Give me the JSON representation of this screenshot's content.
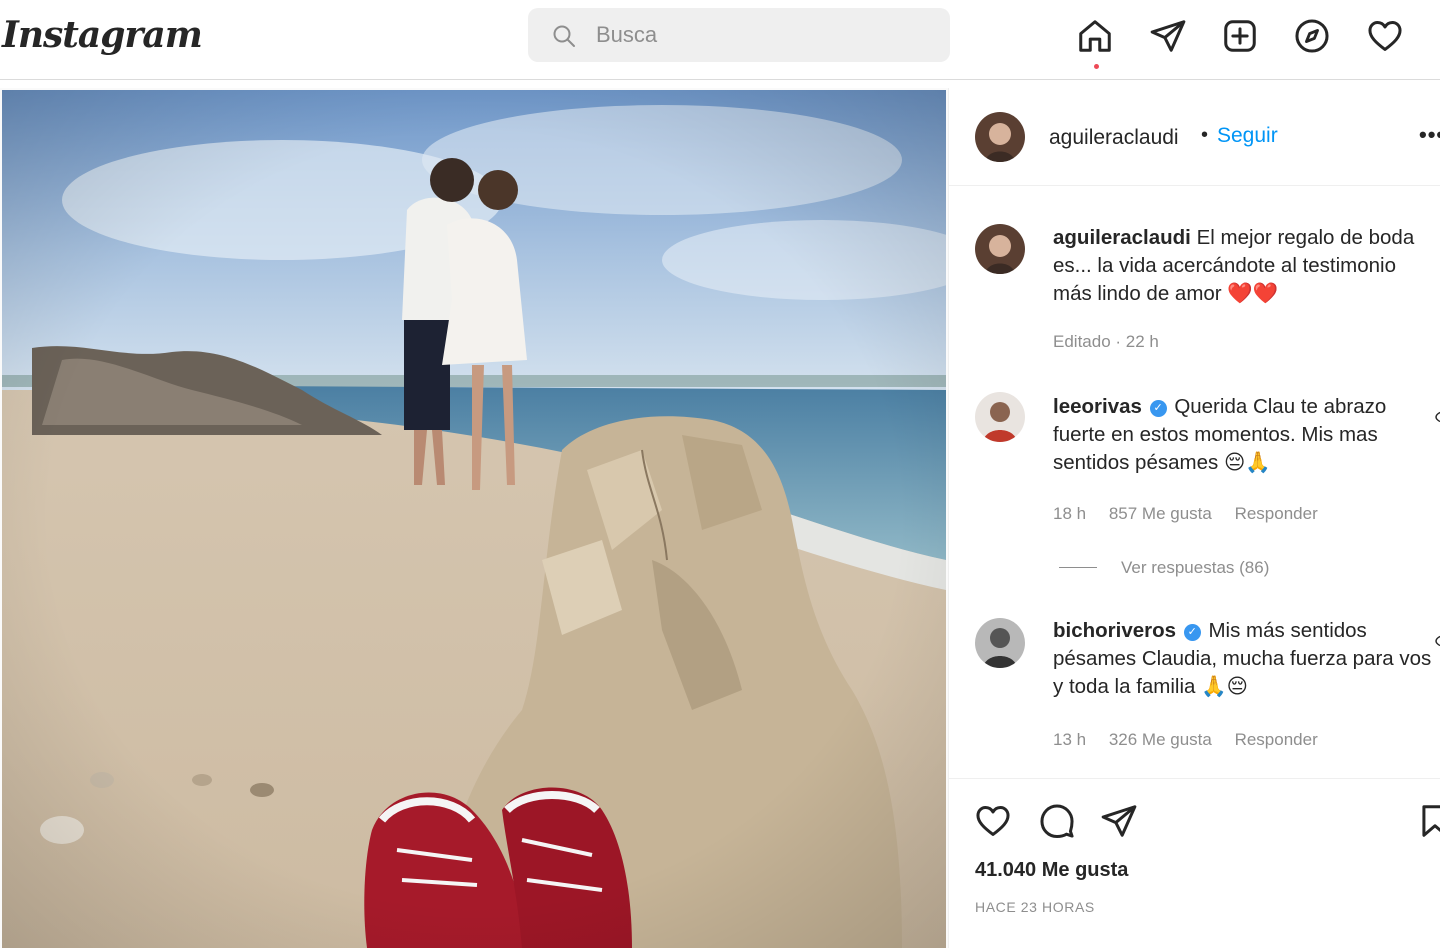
{
  "nav": {
    "logo": "Instagram",
    "search_placeholder": "Busca",
    "icons": [
      "home-icon",
      "direct-send-icon",
      "new-post-icon",
      "explore-compass-icon",
      "activity-heart-icon"
    ]
  },
  "post": {
    "author": "aguileraclaudi",
    "separator": "•",
    "follow_label": "Seguir",
    "more_label": "•••",
    "caption": {
      "username": "aguileraclaudi",
      "text": "El mejor regalo de boda es... la vida acercándote al testimonio más lindo de amor",
      "emojis": "❤️❤️",
      "meta": "Editado · 22 h"
    },
    "comments": [
      {
        "username": "leeorivas",
        "verified": true,
        "text": "Querida Clau te abrazo fuerte en estos momentos. Mis mas sentidos pésames",
        "emojis": "😔🙏",
        "time": "18 h",
        "likes": "857 Me gusta",
        "reply_label": "Responder",
        "view_replies": "Ver respuestas (86)"
      },
      {
        "username": "bichoriveros",
        "verified": true,
        "text": "Mis más sentidos pésames Claudia, mucha fuerza para vos y toda la familia",
        "emojis": "🙏😔",
        "time": "13 h",
        "likes": "326 Me gusta",
        "reply_label": "Responder"
      }
    ],
    "like_count": "41.040 Me gusta",
    "timestamp": "HACE 23 HORAS"
  },
  "colors": {
    "link_blue": "#0095f6",
    "text": "#262626",
    "secondary": "#8e8e8e",
    "notification_dot": "#ed4956",
    "verified": "#3897f0"
  }
}
